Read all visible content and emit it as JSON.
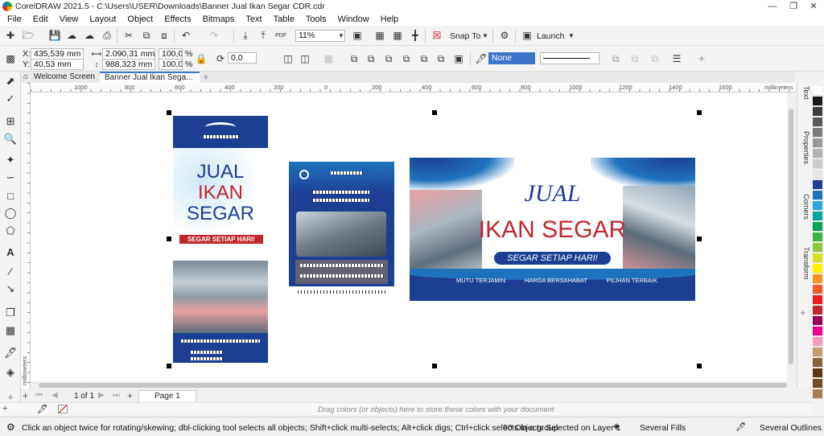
{
  "window": {
    "title": "CorelDRAW 2021.5 - C:\\Users\\USER\\Downloads\\Banner Jual Ikan Segar CDR.cdr"
  },
  "menu": [
    "File",
    "Edit",
    "View",
    "Layout",
    "Object",
    "Effects",
    "Bitmaps",
    "Text",
    "Table",
    "Tools",
    "Window",
    "Help"
  ],
  "standard_toolbar": {
    "zoom": "11%",
    "snap_to": "Snap To",
    "launch": "Launch"
  },
  "property_bar": {
    "x_label": "X:",
    "x": "435,539 mm",
    "y_label": "Y:",
    "y": "40,53 mm",
    "width": "2.090,31 mm",
    "height": "988,323 mm",
    "scale_w": "100,0",
    "scale_h": "100,0",
    "pct": "%",
    "angle": "0,0",
    "fill_none": "None"
  },
  "tabs": [
    {
      "label": "Welcome Screen"
    },
    {
      "label": "Banner Jual Ikan Sega..."
    }
  ],
  "ruler": {
    "unit": "millimeters",
    "ticks": [
      "1000",
      "800",
      "600",
      "400",
      "200",
      "0",
      "200",
      "400",
      "600",
      "800",
      "1000",
      "1200",
      "1400",
      "1600"
    ]
  },
  "dockers": [
    "Text",
    "Properties",
    "Corners",
    "Transform"
  ],
  "palette": [
    "#ffffff",
    "#1a1a1a",
    "#3d3d3d",
    "#595959",
    "#7a7a7a",
    "#999999",
    "#b3b3b3",
    "#cccccc",
    "#e6e6e6",
    "#1c3f94",
    "#1e73be",
    "#29a8e0",
    "#00a99d",
    "#00a651",
    "#39b54a",
    "#8dc63f",
    "#d7df23",
    "#fff200",
    "#f7941d",
    "#f15a24",
    "#ed1c24",
    "#c1272d",
    "#9e005d",
    "#ec008c",
    "#f49ac1",
    "#c69c6d",
    "#8c6239",
    "#603813",
    "#754c24",
    "#a67c52"
  ],
  "page_nav": {
    "page_of": "1 of 1",
    "page_tab": "Page 1"
  },
  "colortray": {
    "hint": "Drag colors (or objects) here to store these colors with your document"
  },
  "status": {
    "hint": "Click an object twice for rotating/skewing; dbl-clicking tool selects all objects; Shift+click multi-selects; Alt+click digs; Ctrl+click selects in a group",
    "selection": "90 Objects Selected on Layer 1",
    "fill": "Several Fills",
    "outline": "Several Outlines"
  },
  "artwork": {
    "banner_title": "JUAL",
    "banner_subtitle": "IKAN SEGAR",
    "banner_ribbon": "SEGAR SETIAP HARI!",
    "banner_strip": [
      "MUTU TERJAMIN",
      "HARGA BERSAHABAT",
      "PILIHAN TERBAIK"
    ],
    "x_line1": "JUAL",
    "x_line2": "IKAN",
    "x_line3": "SEGAR",
    "x_ribbon": "SEGAR SETIAP HARI!"
  }
}
